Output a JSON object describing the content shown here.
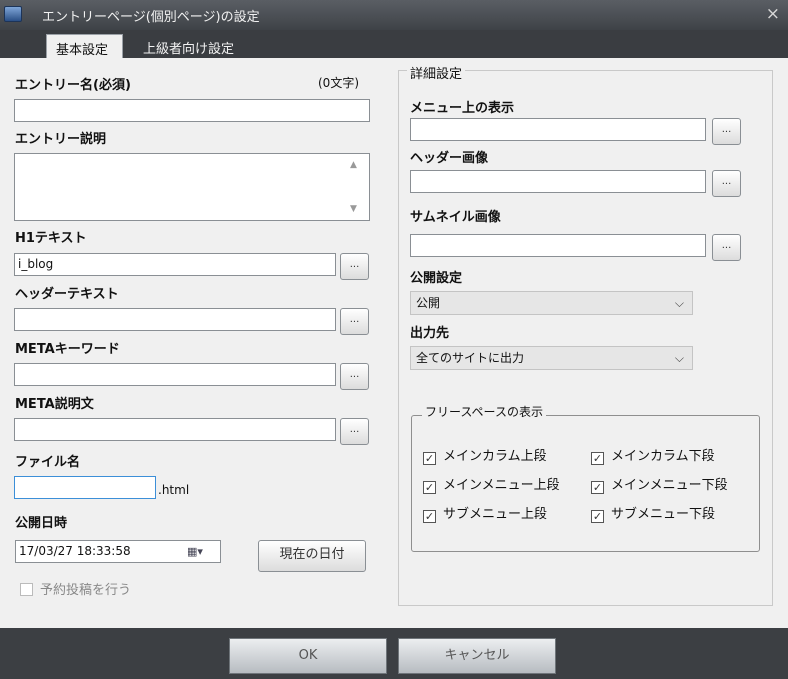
{
  "window": {
    "title": "エントリーページ(個別ページ)の設定",
    "close_glyph": "×",
    "app_icon": "app-icon"
  },
  "tabs": [
    {
      "label": "基本設定",
      "active": true
    },
    {
      "label": "上級者向け設定",
      "active": false
    }
  ],
  "left": {
    "entry_name_label": "エントリー名(必須)",
    "entry_name_count": "(0文字)",
    "entry_name_value": "",
    "entry_desc_label": "エントリー説明",
    "entry_desc_value": "",
    "h1_label": "H1テキスト",
    "h1_value": "i_blog",
    "header_text_label": "ヘッダーテキスト",
    "header_text_value": "",
    "meta_kw_label": "METAキーワード",
    "meta_kw_value": "",
    "meta_desc_label": "META説明文",
    "meta_desc_value": "",
    "filename_label": "ファイル名",
    "filename_value": "",
    "filename_suffix": ".html",
    "publish_dt_label": "公開日時",
    "publish_dt_value": "17/03/27 18:33:58",
    "today_button": "現在の日付",
    "schedule_label": "予約投稿を行う",
    "schedule_checked": false
  },
  "ellipsis": "...",
  "right": {
    "group_title": "詳細設定",
    "menu_label": "メニュー上の表示",
    "menu_value": "",
    "header_img_label": "ヘッダー画像",
    "header_img_value": "",
    "thumb_label": "サムネイル画像",
    "thumb_value": "",
    "publish_label": "公開設定",
    "publish_value": "公開",
    "output_label": "出力先",
    "output_value": "全てのサイトに出力",
    "free_space_title": "フリースペースの表示",
    "free_space": [
      {
        "label": "メインカラム上段",
        "checked": true
      },
      {
        "label": "メインカラム下段",
        "checked": true
      },
      {
        "label": "メインメニュー上段",
        "checked": true
      },
      {
        "label": "メインメニュー下段",
        "checked": true
      },
      {
        "label": "サブメニュー上段",
        "checked": true
      },
      {
        "label": "サブメニュー下段",
        "checked": true
      }
    ]
  },
  "footer": {
    "ok": "OK",
    "cancel": "キャンセル"
  },
  "check_glyph": "✓",
  "chevron_glyph": "⌵",
  "colors": {
    "titlebar": "#4a4e53",
    "content_bg": "#f0f0f0",
    "footer_bg": "#3c3f43"
  }
}
